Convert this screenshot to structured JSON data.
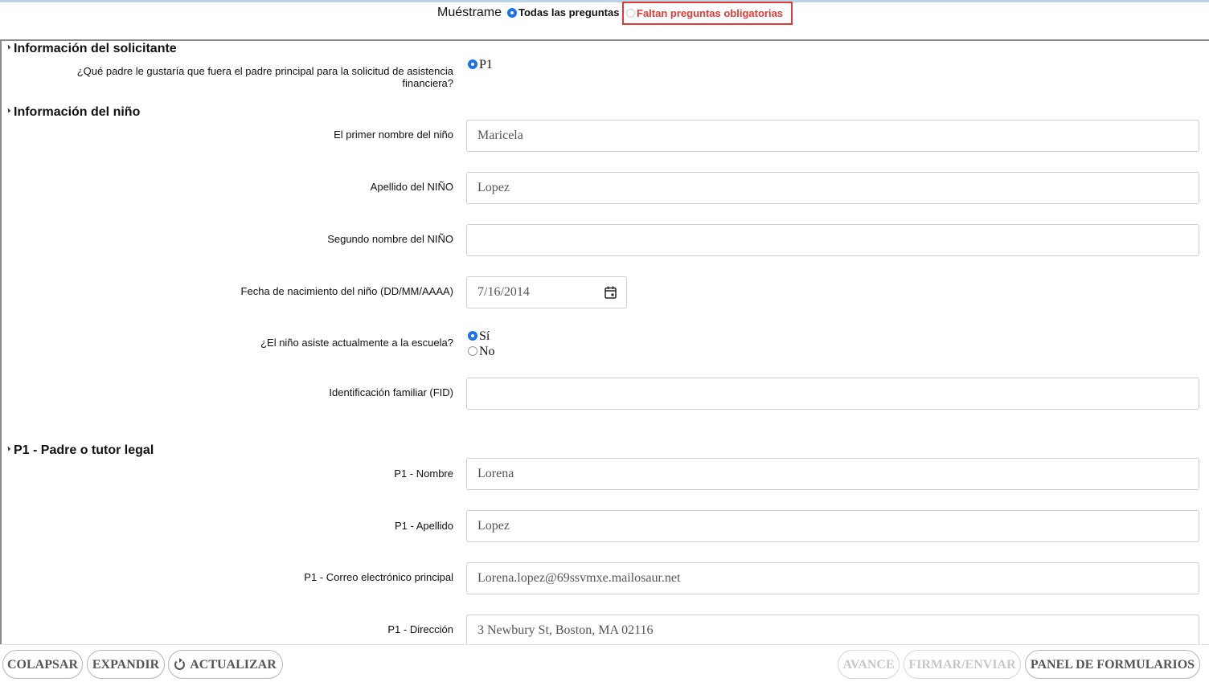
{
  "filter": {
    "show_label": "Muéstrame",
    "all_label": "Todas las preguntas",
    "missing_label": "Faltan preguntas obligatorias",
    "selected": "all"
  },
  "sections": {
    "applicant": {
      "title": "Información del solicitante",
      "primary_parent_question_line1": "¿Qué padre le gustaría que fuera el padre principal para la solicitud de asistencia",
      "primary_parent_question_line2": "financiera?",
      "primary_parent_option": "P1"
    },
    "child": {
      "title": "Información del niño",
      "first_name_label": "El primer nombre del niño",
      "first_name_value": "Maricela",
      "last_name_label": "Apellido del NIÑO",
      "last_name_value": "Lopez",
      "middle_name_label": "Segundo nombre del NIÑO",
      "middle_name_value": "",
      "dob_label": "Fecha de nacimiento del niño (DD/MM/AAAA)",
      "dob_value": "7/16/2014",
      "attends_school_label": "¿El niño asiste actualmente a la escuela?",
      "attends_school_yes": "Sí",
      "attends_school_no": "No",
      "attends_school_selected": "Sí",
      "fid_label": "Identificación familiar (FID)",
      "fid_value": ""
    },
    "parent1": {
      "title": "P1 - Padre o tutor legal",
      "first_name_label": "P1 - Nombre",
      "first_name_value": "Lorena",
      "last_name_label": "P1 - Apellido",
      "last_name_value": "Lopez",
      "email_label": "P1 - Correo electrónico principal",
      "email_value": "Lorena.lopez@69ssvmxe.mailosaur.net",
      "address_label": "P1 - Dirección",
      "address_value": "3 Newbury St, Boston, MA 02116"
    }
  },
  "toolbar": {
    "collapse": "COLAPSAR",
    "expand": "EXPANDIR",
    "refresh": "ACTUALIZAR",
    "advance": "AVANCE",
    "sign_submit": "FIRMAR/ENVIAR",
    "forms_panel": "PANEL DE FORMULARIOS"
  },
  "colors": {
    "accent": "#1a73e8",
    "error": "#e53935",
    "disabled_text": "#c8c8c8"
  }
}
